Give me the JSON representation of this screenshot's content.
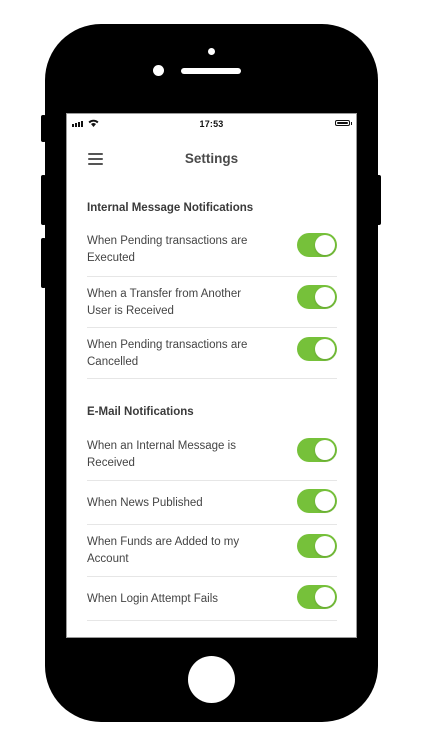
{
  "status_bar": {
    "time": "17:53"
  },
  "header": {
    "title": "Settings",
    "menu_icon": "hamburger-menu-icon"
  },
  "sections": [
    {
      "title": "Internal Message Notifications",
      "items": [
        {
          "label": "When Pending transactions are Executed",
          "enabled": true
        },
        {
          "label": "When a Transfer from Another User is Received",
          "enabled": true
        },
        {
          "label": "When Pending transactions are Cancelled",
          "enabled": true
        }
      ]
    },
    {
      "title": "E-Mail Notifications",
      "items": [
        {
          "label": "When an Internal Message is Received",
          "enabled": true
        },
        {
          "label": "When News Published",
          "enabled": true
        },
        {
          "label": "When Funds are Added to my Account",
          "enabled": true
        },
        {
          "label": "When Login Attempt Fails",
          "enabled": true
        }
      ]
    }
  ],
  "colors": {
    "toggle_on": "#76c13a",
    "title_text": "#4a4a4a",
    "divider": "#e6e6e6"
  }
}
